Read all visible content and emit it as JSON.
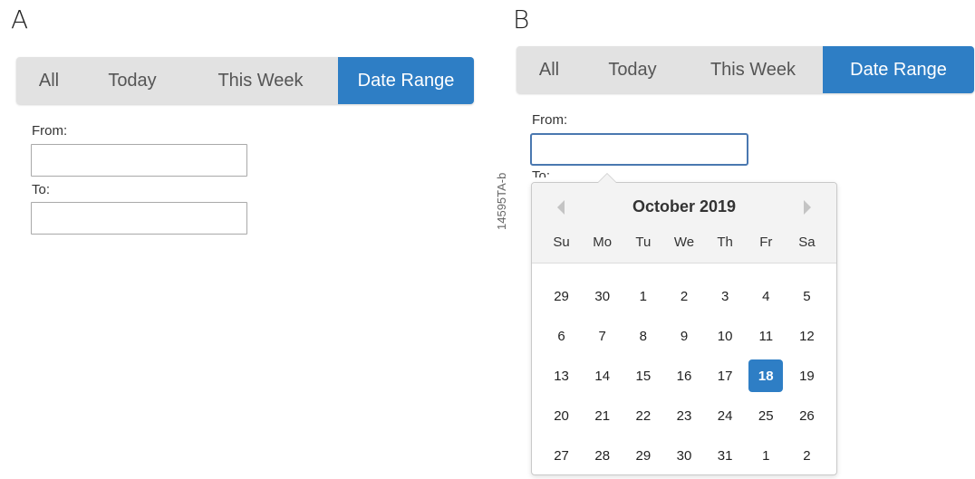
{
  "panels": {
    "a": {
      "letter": "A",
      "tabs": [
        {
          "label": "All",
          "active": false
        },
        {
          "label": "Today",
          "active": false
        },
        {
          "label": "This Week",
          "active": false
        },
        {
          "label": "Date Range",
          "active": true
        }
      ],
      "from_label": "From:",
      "from_value": "",
      "to_label": "To:",
      "to_value": ""
    },
    "b": {
      "letter": "B",
      "tabs": [
        {
          "label": "All",
          "active": false
        },
        {
          "label": "Today",
          "active": false
        },
        {
          "label": "This Week",
          "active": false
        },
        {
          "label": "Date Range",
          "active": true
        }
      ],
      "from_label": "From:",
      "from_value": "",
      "to_label": "To:",
      "calendar": {
        "title": "October 2019",
        "prev_icon": "chevron-left-icon",
        "next_icon": "chevron-right-icon",
        "weekdays": [
          "Su",
          "Mo",
          "Tu",
          "We",
          "Th",
          "Fr",
          "Sa"
        ],
        "weeks": [
          [
            "29",
            "30",
            "1",
            "2",
            "3",
            "4",
            "5"
          ],
          [
            "6",
            "7",
            "8",
            "9",
            "10",
            "11",
            "12"
          ],
          [
            "13",
            "14",
            "15",
            "16",
            "17",
            "18",
            "19"
          ],
          [
            "20",
            "21",
            "22",
            "23",
            "24",
            "25",
            "26"
          ],
          [
            "27",
            "28",
            "29",
            "30",
            "31",
            "1",
            "2"
          ]
        ],
        "selected_day": "18"
      }
    }
  },
  "figure_id": "14595TA-b",
  "colors": {
    "accent": "#2e7ec5",
    "tab_bar": "#e2e2e2",
    "focus_border": "#4a78b0"
  }
}
